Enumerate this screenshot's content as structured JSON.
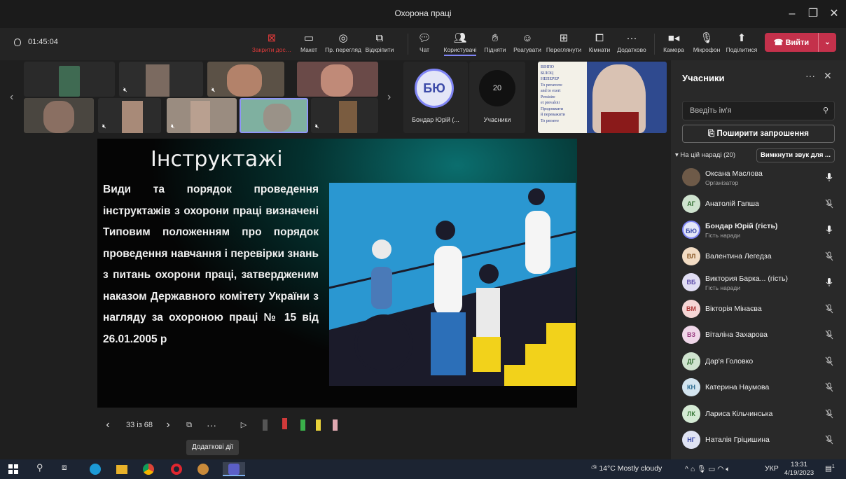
{
  "window": {
    "title": "Охорона праці"
  },
  "toolbar": {
    "timer": "01:45:04",
    "buttons": [
      {
        "label": "Закрити дос…",
        "icon": "close-share-icon"
      },
      {
        "label": "Макет",
        "icon": "layout-icon"
      },
      {
        "label": "Пр. перегляд",
        "icon": "eye-icon"
      },
      {
        "label": "Відкріпити",
        "icon": "popout-icon"
      },
      {
        "label": "Чат",
        "icon": "chat-icon"
      },
      {
        "label": "Користувачі",
        "icon": "people-icon"
      },
      {
        "label": "Підняти",
        "icon": "raise-hand-icon"
      },
      {
        "label": "Реагувати",
        "icon": "smile-icon"
      },
      {
        "label": "Переглянути",
        "icon": "grid-icon"
      },
      {
        "label": "Кімнати",
        "icon": "rooms-icon"
      },
      {
        "label": "Додатково",
        "icon": "more-icon"
      },
      {
        "label": "Камера",
        "icon": "camera-icon"
      },
      {
        "label": "Мікрофон",
        "icon": "mic-icon"
      },
      {
        "label": "Поділитися",
        "icon": "share-icon"
      }
    ],
    "leave_label": "Вийти"
  },
  "stage": {
    "presenter_initials": "БЮ",
    "presenter_name": "Бондар Юрій (...",
    "participants_count": "20",
    "participants_label": "Учасники",
    "slide": {
      "title": "Інструктажі",
      "text": "Види та порядок проведення інструктажів з охорони праці визначені Типовим положенням про порядок проведення навчання і перевірки знань з питань охорони праці, затвердженим наказом Державного комітету України з нагляду за охороною праці № 15 від 26.01.2005 р"
    },
    "poster": {
      "lines": [
        "ВІНПО",
        "БІЛОЦ",
        "НЕПЕРЕР",
        "To persevere",
        "and to exert",
        "Persistre",
        "et prevaloir",
        "Продовжити",
        "й переважити",
        "To perseve"
      ]
    },
    "controls": {
      "page": "33 із 68",
      "tooltip": "Додаткові дії"
    }
  },
  "panel": {
    "title": "Учасники",
    "search_placeholder": "Введіть ім'я",
    "invite_label": "Поширити запрошення",
    "in_meeting": "На цій нараді (20)",
    "mute_all": "Вимкнути звук для ...",
    "participants": [
      {
        "initials": "",
        "name": "Оксана Маслова",
        "sub": "Організатор",
        "mic": "on",
        "color": "#6e5a48",
        "text": "#fff"
      },
      {
        "initials": "АГ",
        "name": "Анатолій Гапша",
        "sub": "",
        "mic": "off",
        "color": "#cfe3cf",
        "text": "#2e6b2e"
      },
      {
        "initials": "БЮ",
        "name": "Бондар Юрій (гість)",
        "sub": "Гість наради",
        "mic": "on",
        "color": "#e3e6f7",
        "text": "#3b4aa8"
      },
      {
        "initials": "ВЛ",
        "name": "Валентина Легедза",
        "sub": "",
        "mic": "off",
        "color": "#f2dcc4",
        "text": "#8a5a28"
      },
      {
        "initials": "ВБ",
        "name": "Виктория Барка... (гість)",
        "sub": "Гість наради",
        "mic": "on",
        "color": "#e1def3",
        "text": "#5b4aa8"
      },
      {
        "initials": "ВМ",
        "name": "Вікторія Мінаєва",
        "sub": "",
        "mic": "off",
        "color": "#f6d6d6",
        "text": "#b03a3a"
      },
      {
        "initials": "ВЗ",
        "name": "Віталіна Захарова",
        "sub": "",
        "mic": "off",
        "color": "#f0d7e9",
        "text": "#9a3c80"
      },
      {
        "initials": "ДГ",
        "name": "Дар'я Головко",
        "sub": "",
        "mic": "off",
        "color": "#cfe3cf",
        "text": "#2e6b2e"
      },
      {
        "initials": "КН",
        "name": "Катерина Наумова",
        "sub": "",
        "mic": "off",
        "color": "#d3e4ef",
        "text": "#2b6a8f"
      },
      {
        "initials": "ЛК",
        "name": "Лариса Кільчинська",
        "sub": "",
        "mic": "off",
        "color": "#d4ead4",
        "text": "#3a7a3a"
      },
      {
        "initials": "НГ",
        "name": "Наталія Гріцишина",
        "sub": "",
        "mic": "off",
        "color": "#dfe3f3",
        "text": "#3b4aa8"
      }
    ]
  },
  "taskbar": {
    "weather": "14°C  Mostly cloudy",
    "lang": "УКР",
    "time": "13:31",
    "date": "4/19/2023",
    "notif": "1"
  },
  "colors": {
    "accent": "#7f85f5",
    "leave": "#c4314b",
    "panel": "#292929"
  }
}
